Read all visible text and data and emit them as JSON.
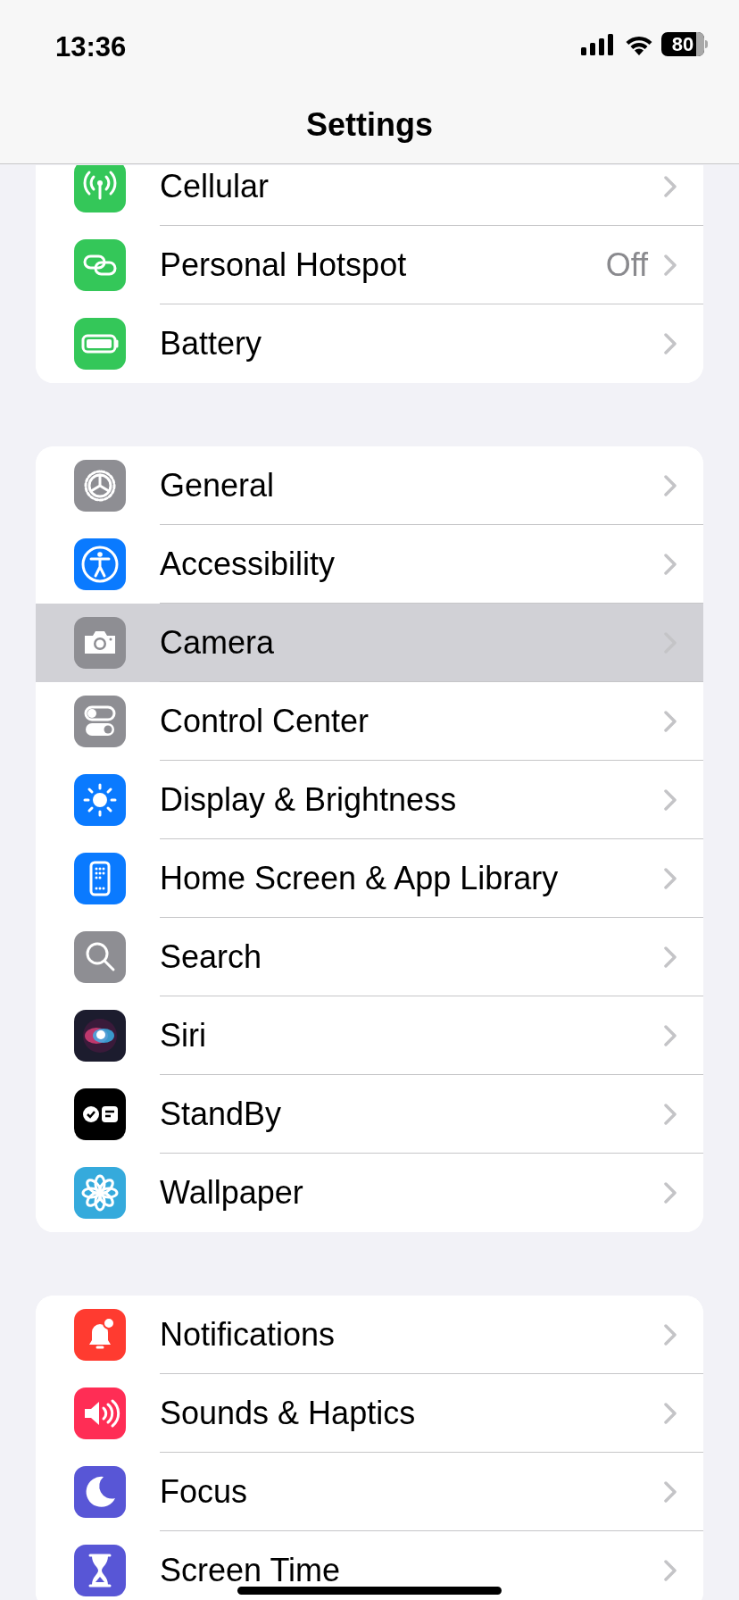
{
  "status_bar": {
    "time": "13:36",
    "battery": "80"
  },
  "title": "Settings",
  "groups": [
    {
      "rows": [
        {
          "label": "Cellular",
          "selected": false
        },
        {
          "label": "Personal Hotspot",
          "value": "Off",
          "selected": false
        },
        {
          "label": "Battery",
          "selected": false
        }
      ]
    },
    {
      "rows": [
        {
          "label": "General",
          "selected": false
        },
        {
          "label": "Accessibility",
          "selected": false
        },
        {
          "label": "Camera",
          "selected": true
        },
        {
          "label": "Control Center",
          "selected": false
        },
        {
          "label": "Display & Brightness",
          "selected": false
        },
        {
          "label": "Home Screen & App Library",
          "selected": false
        },
        {
          "label": "Search",
          "selected": false
        },
        {
          "label": "Siri",
          "selected": false
        },
        {
          "label": "StandBy",
          "selected": false
        },
        {
          "label": "Wallpaper",
          "selected": false
        }
      ]
    },
    {
      "rows": [
        {
          "label": "Notifications",
          "selected": false
        },
        {
          "label": "Sounds & Haptics",
          "selected": false
        },
        {
          "label": "Focus",
          "selected": false
        },
        {
          "label": "Screen Time",
          "selected": false
        }
      ]
    }
  ]
}
